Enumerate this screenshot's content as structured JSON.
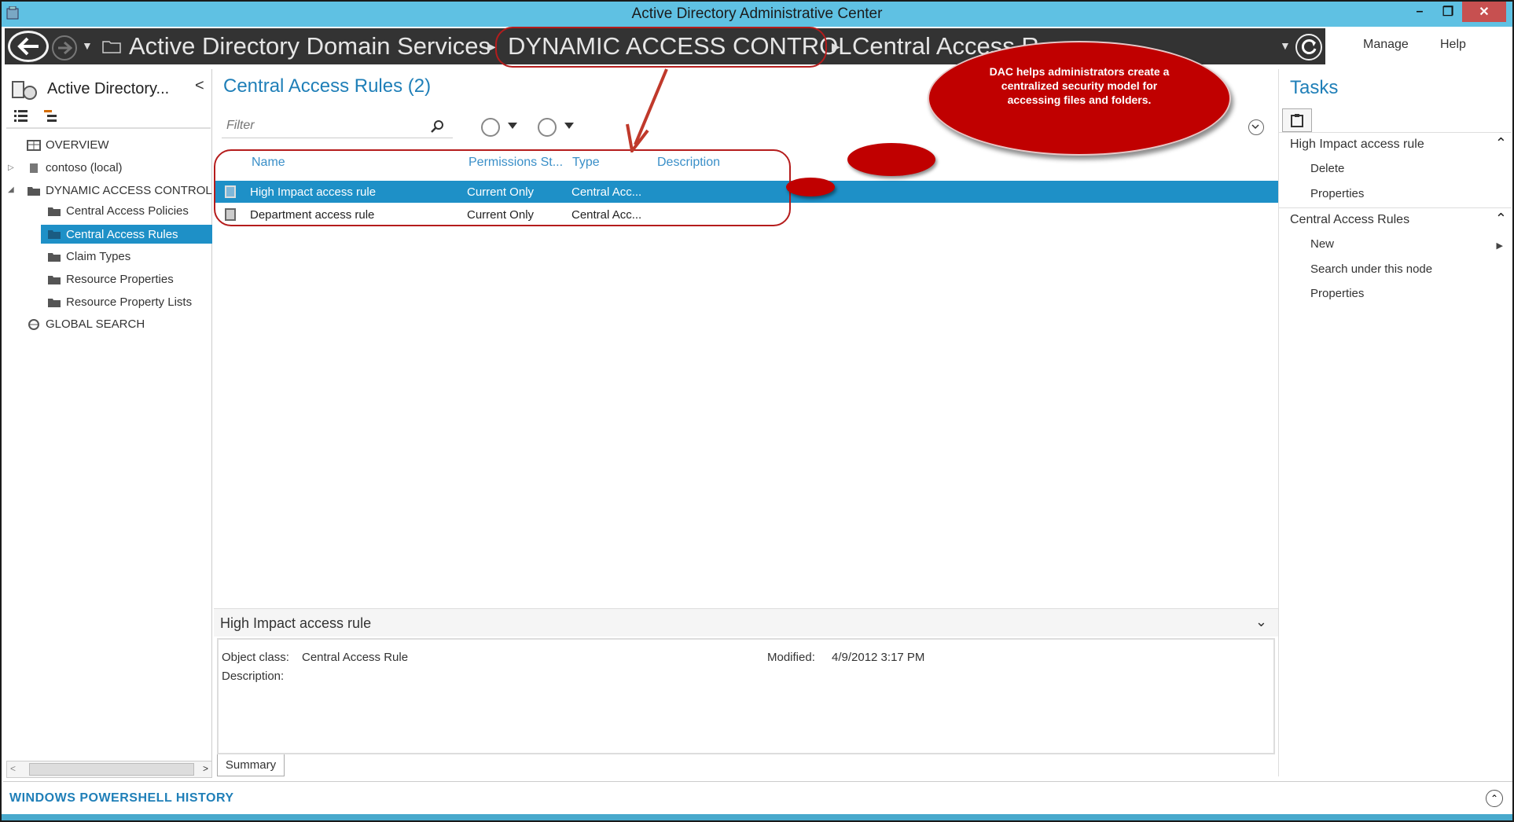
{
  "window": {
    "title": "Active Directory Administrative Center",
    "minimize": "–",
    "restore": "❐",
    "close": "✕"
  },
  "nav": {
    "breadcrumbs": [
      "Active Directory Domain Services",
      "DYNAMIC ACCESS CONTROL",
      "Central Access R"
    ],
    "menu": {
      "manage": "Manage",
      "help": "Help"
    }
  },
  "sidebar": {
    "title": "Active Directory...",
    "items": [
      {
        "label": "OVERVIEW"
      },
      {
        "label": "contoso (local)"
      },
      {
        "label": "DYNAMIC ACCESS CONTROL"
      },
      {
        "label": "Central Access Policies"
      },
      {
        "label": "Central Access Rules"
      },
      {
        "label": "Claim Types"
      },
      {
        "label": "Resource Properties"
      },
      {
        "label": "Resource Property Lists"
      },
      {
        "label": "GLOBAL SEARCH"
      }
    ]
  },
  "main": {
    "title": "Central Access Rules  (2)",
    "filter_placeholder": "Filter",
    "columns": {
      "name": "Name",
      "permissions": "Permissions St...",
      "type": "Type",
      "description": "Description"
    },
    "rows": [
      {
        "name": "High Impact access rule",
        "permissions": "Current Only",
        "type": "Central Acc..."
      },
      {
        "name": "Department access rule",
        "permissions": "Current Only",
        "type": "Central Acc..."
      }
    ]
  },
  "details": {
    "title": "High Impact access rule",
    "object_class_label": "Object class:",
    "object_class_value": "Central Access Rule",
    "modified_label": "Modified:",
    "modified_value": "4/9/2012 3:17 PM",
    "description_label": "Description:",
    "summary_tab": "Summary"
  },
  "tasks": {
    "title": "Tasks",
    "section1": {
      "title": "High Impact access rule",
      "items": [
        "Delete",
        "Properties"
      ]
    },
    "section2": {
      "title": "Central Access Rules",
      "items": [
        "New",
        "Search under this node",
        "Properties"
      ]
    }
  },
  "bottom": {
    "powershell_history": "WINDOWS POWERSHELL HISTORY"
  },
  "annotation": {
    "callout_text": "DAC helps administrators create a centralized security model for accessing files and folders.",
    "color": "#c00000"
  },
  "colors": {
    "accent": "#1f7fb8",
    "selection": "#1e90c7",
    "titlebar": "#5fc1e3",
    "navbar": "#333333"
  }
}
